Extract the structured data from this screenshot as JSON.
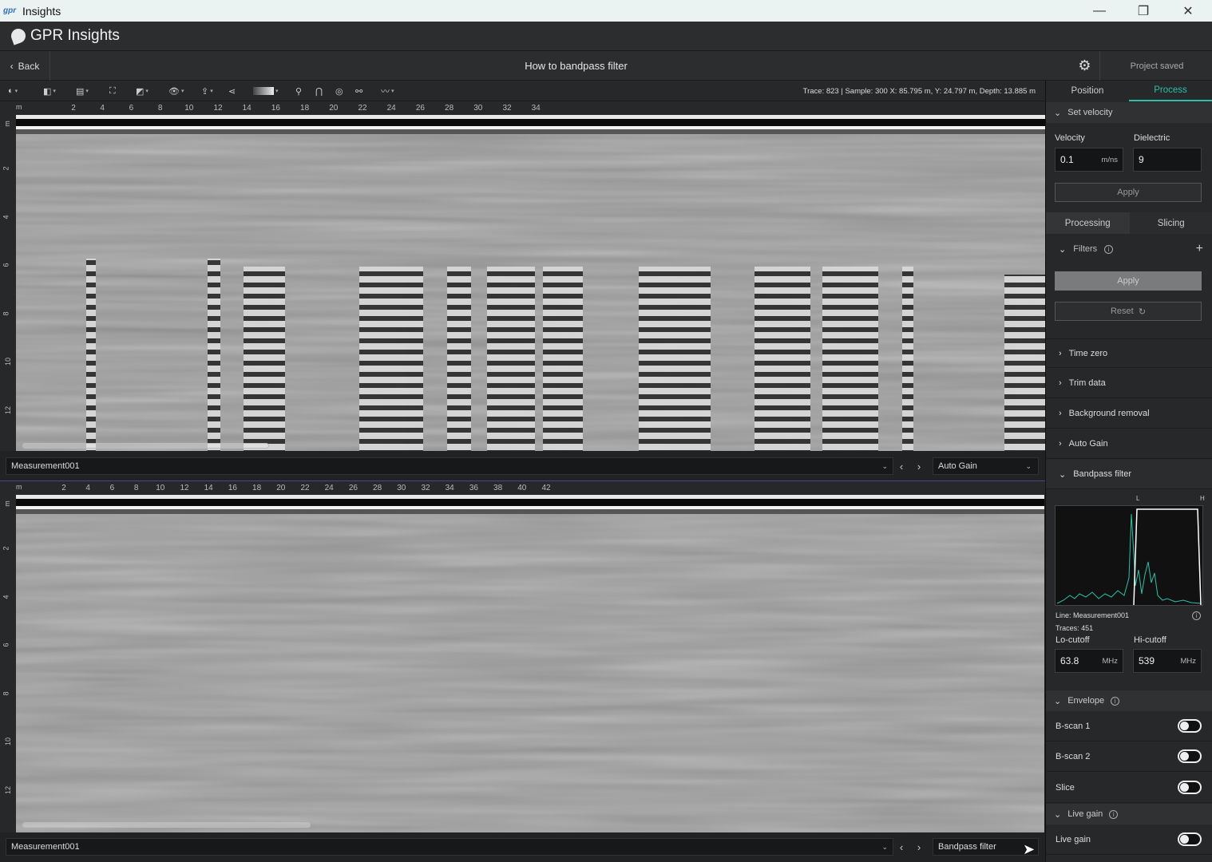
{
  "window": {
    "logo_text": "gpr",
    "title": "Insights",
    "minimize": "—",
    "maximize": "❐",
    "close": "✕"
  },
  "app": {
    "brand": "GPR Insights"
  },
  "nav": {
    "back_label": "Back",
    "page_title": "How to bandpass filter",
    "status": "Project saved"
  },
  "toolbar": {
    "readout": "Trace: 823 | Sample: 300    X: 85.795 m, Y: 24.797 m, Depth: 13.885 m"
  },
  "panels": [
    {
      "x_unit": "m",
      "x_ticks": [
        "2",
        "4",
        "6",
        "8",
        "10",
        "12",
        "14",
        "16",
        "18",
        "20",
        "22",
        "24",
        "26",
        "28",
        "30",
        "32",
        "34"
      ],
      "y_unit": "m",
      "y_ticks": [
        "2",
        "4",
        "6",
        "8",
        "10",
        "12"
      ],
      "line_select": "Measurement001",
      "processing_select": "Auto Gain",
      "scroll_fraction": 0.24
    },
    {
      "x_unit": "m",
      "x_ticks": [
        "2",
        "4",
        "6",
        "8",
        "10",
        "12",
        "14",
        "16",
        "18",
        "20",
        "22",
        "24",
        "26",
        "28",
        "30",
        "32",
        "34",
        "36",
        "38",
        "40",
        "42"
      ],
      "y_unit": "m",
      "y_ticks": [
        "2",
        "4",
        "6",
        "8",
        "10",
        "12"
      ],
      "line_select": "Measurement001",
      "processing_select": "Bandpass filter",
      "scroll_fraction": 0.28
    }
  ],
  "side": {
    "tabs": [
      "Position",
      "Process"
    ],
    "active_tab": "Process",
    "set_velocity": {
      "header": "Set velocity",
      "velocity_label": "Velocity",
      "velocity_value": "0.1",
      "velocity_unit": "m/ns",
      "dielectric_label": "Dielectric",
      "dielectric_value": "9",
      "apply": "Apply"
    },
    "subtabs": [
      "Processing",
      "Slicing"
    ],
    "filters": {
      "header": "Filters",
      "apply": "Apply",
      "reset": "Reset"
    },
    "steps": [
      "Time zero",
      "Trim data",
      "Background removal",
      "Auto Gain",
      "Bandpass filter"
    ],
    "bandpass": {
      "l_marker": "L",
      "h_marker": "H",
      "line_info": "Line: Measurement001",
      "traces_info": "Traces: 451",
      "lo_label": "Lo-cutoff",
      "lo_value": "63.8",
      "lo_unit": "MHz",
      "hi_label": "Hi-cutoff",
      "hi_value": "539",
      "hi_unit": "MHz"
    },
    "envelope": {
      "header": "Envelope",
      "rows": [
        "B-scan 1",
        "B-scan 2",
        "Slice"
      ]
    },
    "live_gain": {
      "header": "Live gain",
      "rows": [
        "Live gain"
      ]
    }
  },
  "colors": {
    "accent": "#2fbfa8",
    "background": "#202224",
    "panel": "#26282a"
  }
}
